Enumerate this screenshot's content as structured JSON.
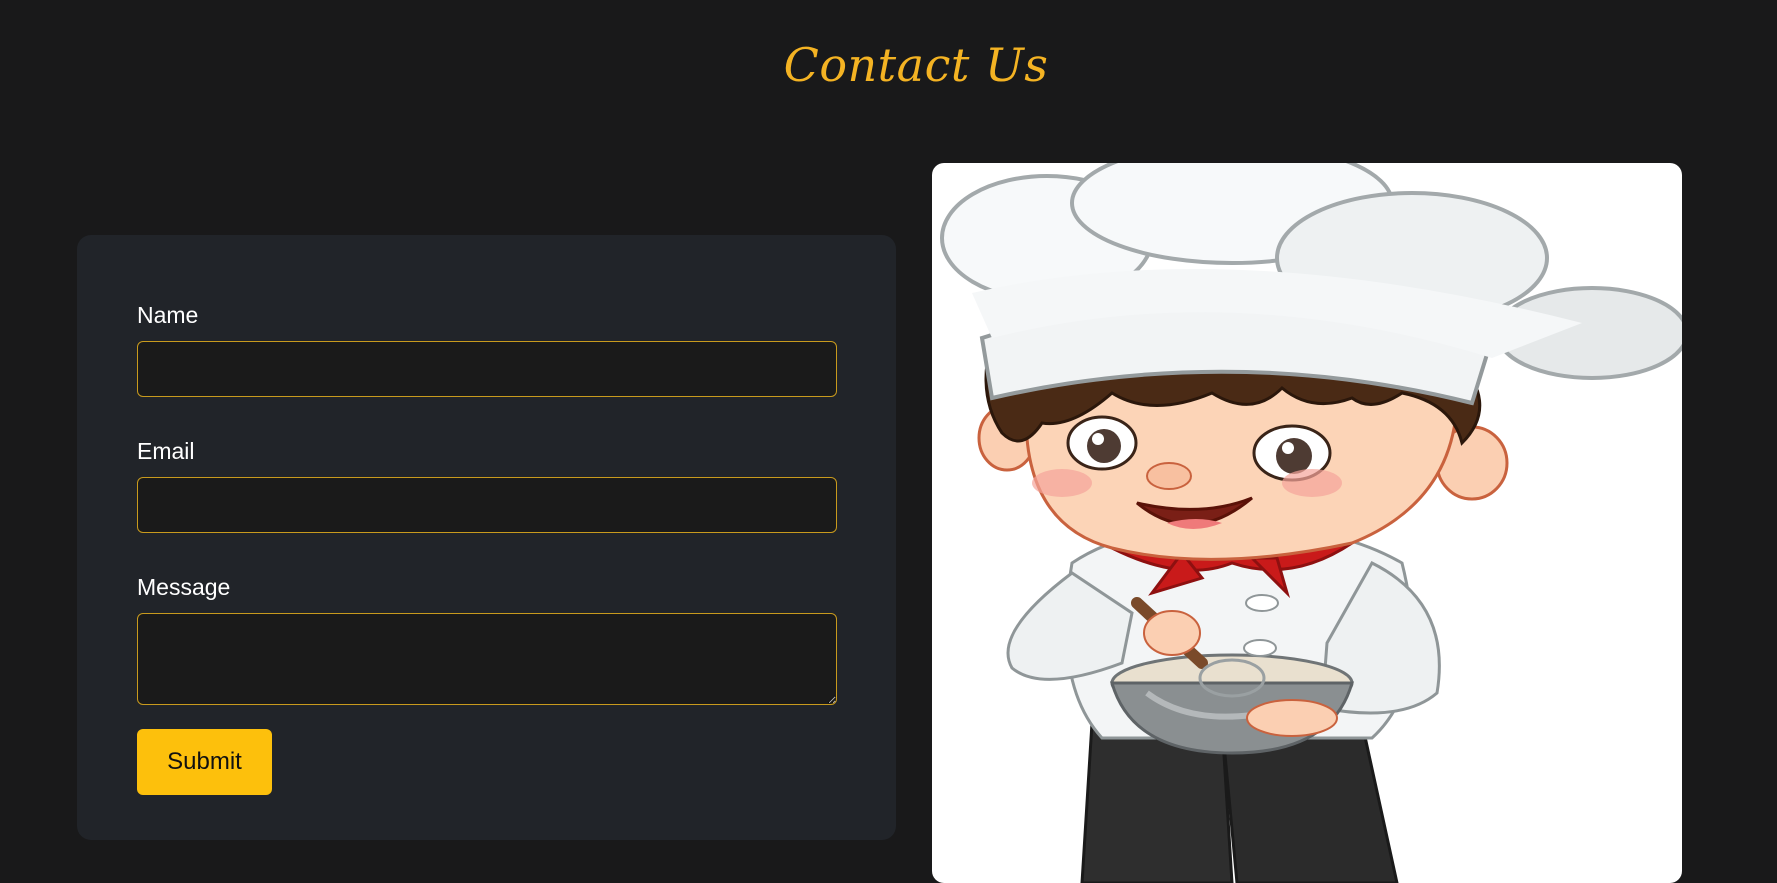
{
  "page": {
    "title": "Contact Us"
  },
  "form": {
    "name_label": "Name",
    "email_label": "Email",
    "message_label": "Message",
    "name_value": "",
    "email_value": "",
    "message_value": "",
    "submit_label": "Submit"
  },
  "illustration": {
    "subject": "cartoon-chef-boy-whisking-bowl"
  },
  "colors": {
    "background": "#19191a",
    "card": "#212429",
    "accent": "#fdc00c",
    "title": "#f4b323",
    "input_border": "#c89a1d"
  }
}
